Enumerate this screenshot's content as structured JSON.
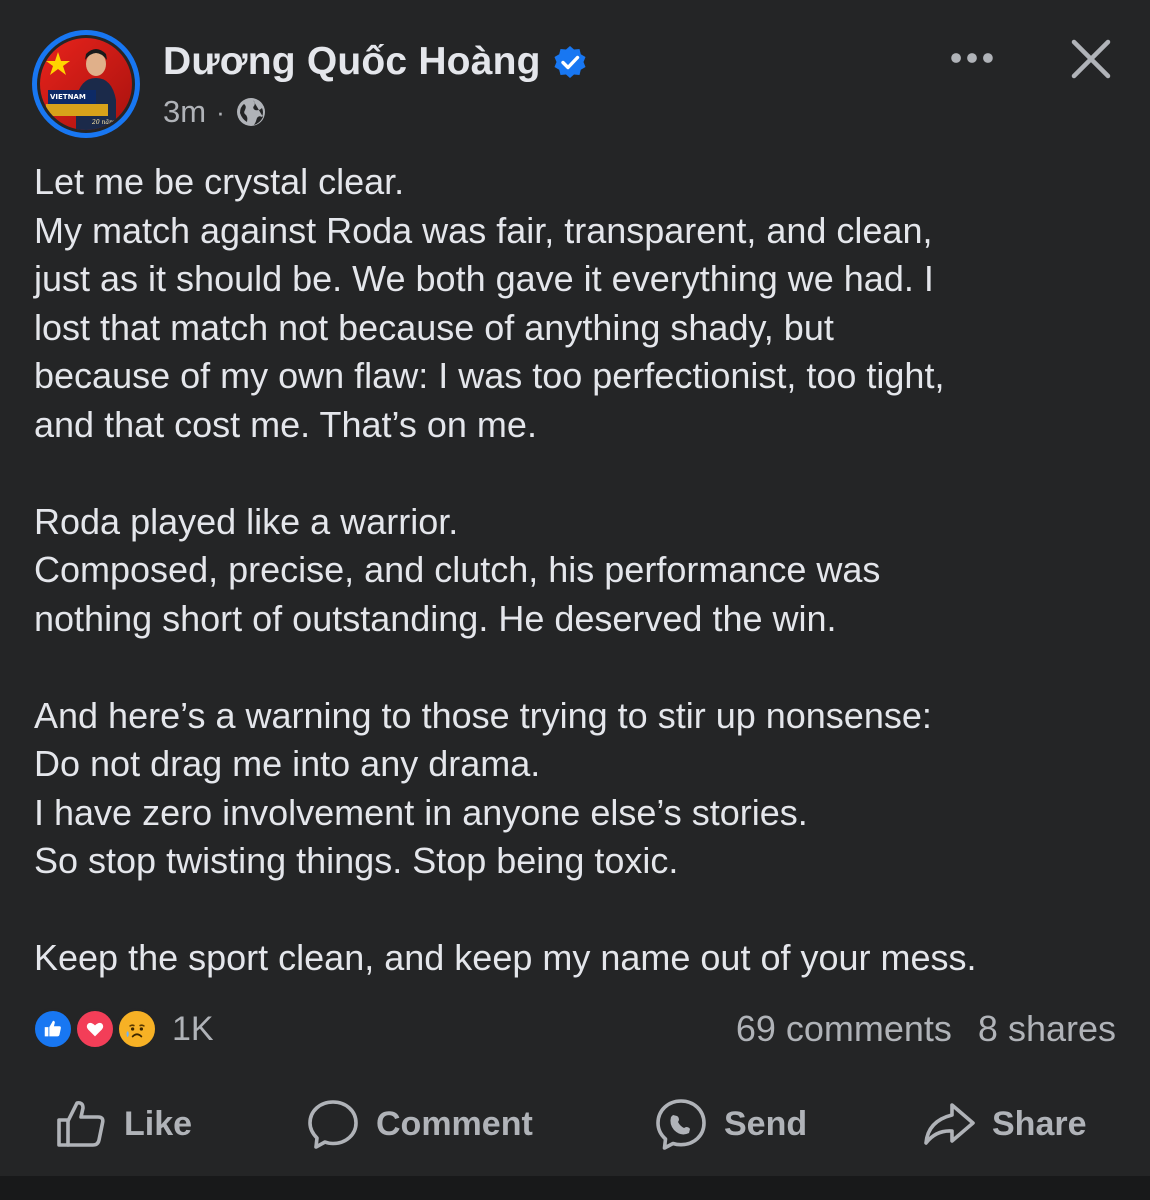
{
  "post": {
    "author": "Dương Quốc Hoàng",
    "time": "3m",
    "separator": "·",
    "audience_icon": "globe-icon",
    "verified_icon": "verified-badge-icon",
    "avatar": {
      "badge_text_1": "VIETNAM",
      "badge_text_2": "20 năm"
    },
    "body": {
      "p1": [
        "Let me be crystal clear.",
        "My match against Roda was fair, transparent, and clean,",
        "just as it should be. We both gave it everything we had. I",
        "lost that match not because of anything shady, but",
        "because of my own flaw: I was too perfectionist, too tight,",
        "and that cost me. That’s on me."
      ],
      "p2": [
        "Roda played like a warrior.",
        "Composed, precise, and clutch, his performance was",
        "nothing short of outstanding. He deserved the win."
      ],
      "p3": [
        "And here’s a warning to those trying to stir up nonsense:",
        "Do not drag me into any drama.",
        "I have zero involvement in anyone else’s stories.",
        "So stop twisting things. Stop being toxic."
      ],
      "p4": [
        "Keep the sport clean, and keep my name out of your mess."
      ]
    },
    "reactions": {
      "icons": [
        "like-reaction-icon",
        "love-reaction-icon",
        "care-reaction-icon"
      ],
      "count": "1K"
    },
    "stats": {
      "comments": "69 comments",
      "shares": "8 shares"
    },
    "actions": {
      "like": "Like",
      "comment": "Comment",
      "send": "Send",
      "share": "Share"
    }
  },
  "colors": {
    "background": "#242526",
    "text_primary": "#e4e6eb",
    "text_secondary": "#b0b3b8",
    "accent_blue": "#1877f2",
    "love_red": "#f33e58",
    "care_yellow": "#f7b125"
  }
}
